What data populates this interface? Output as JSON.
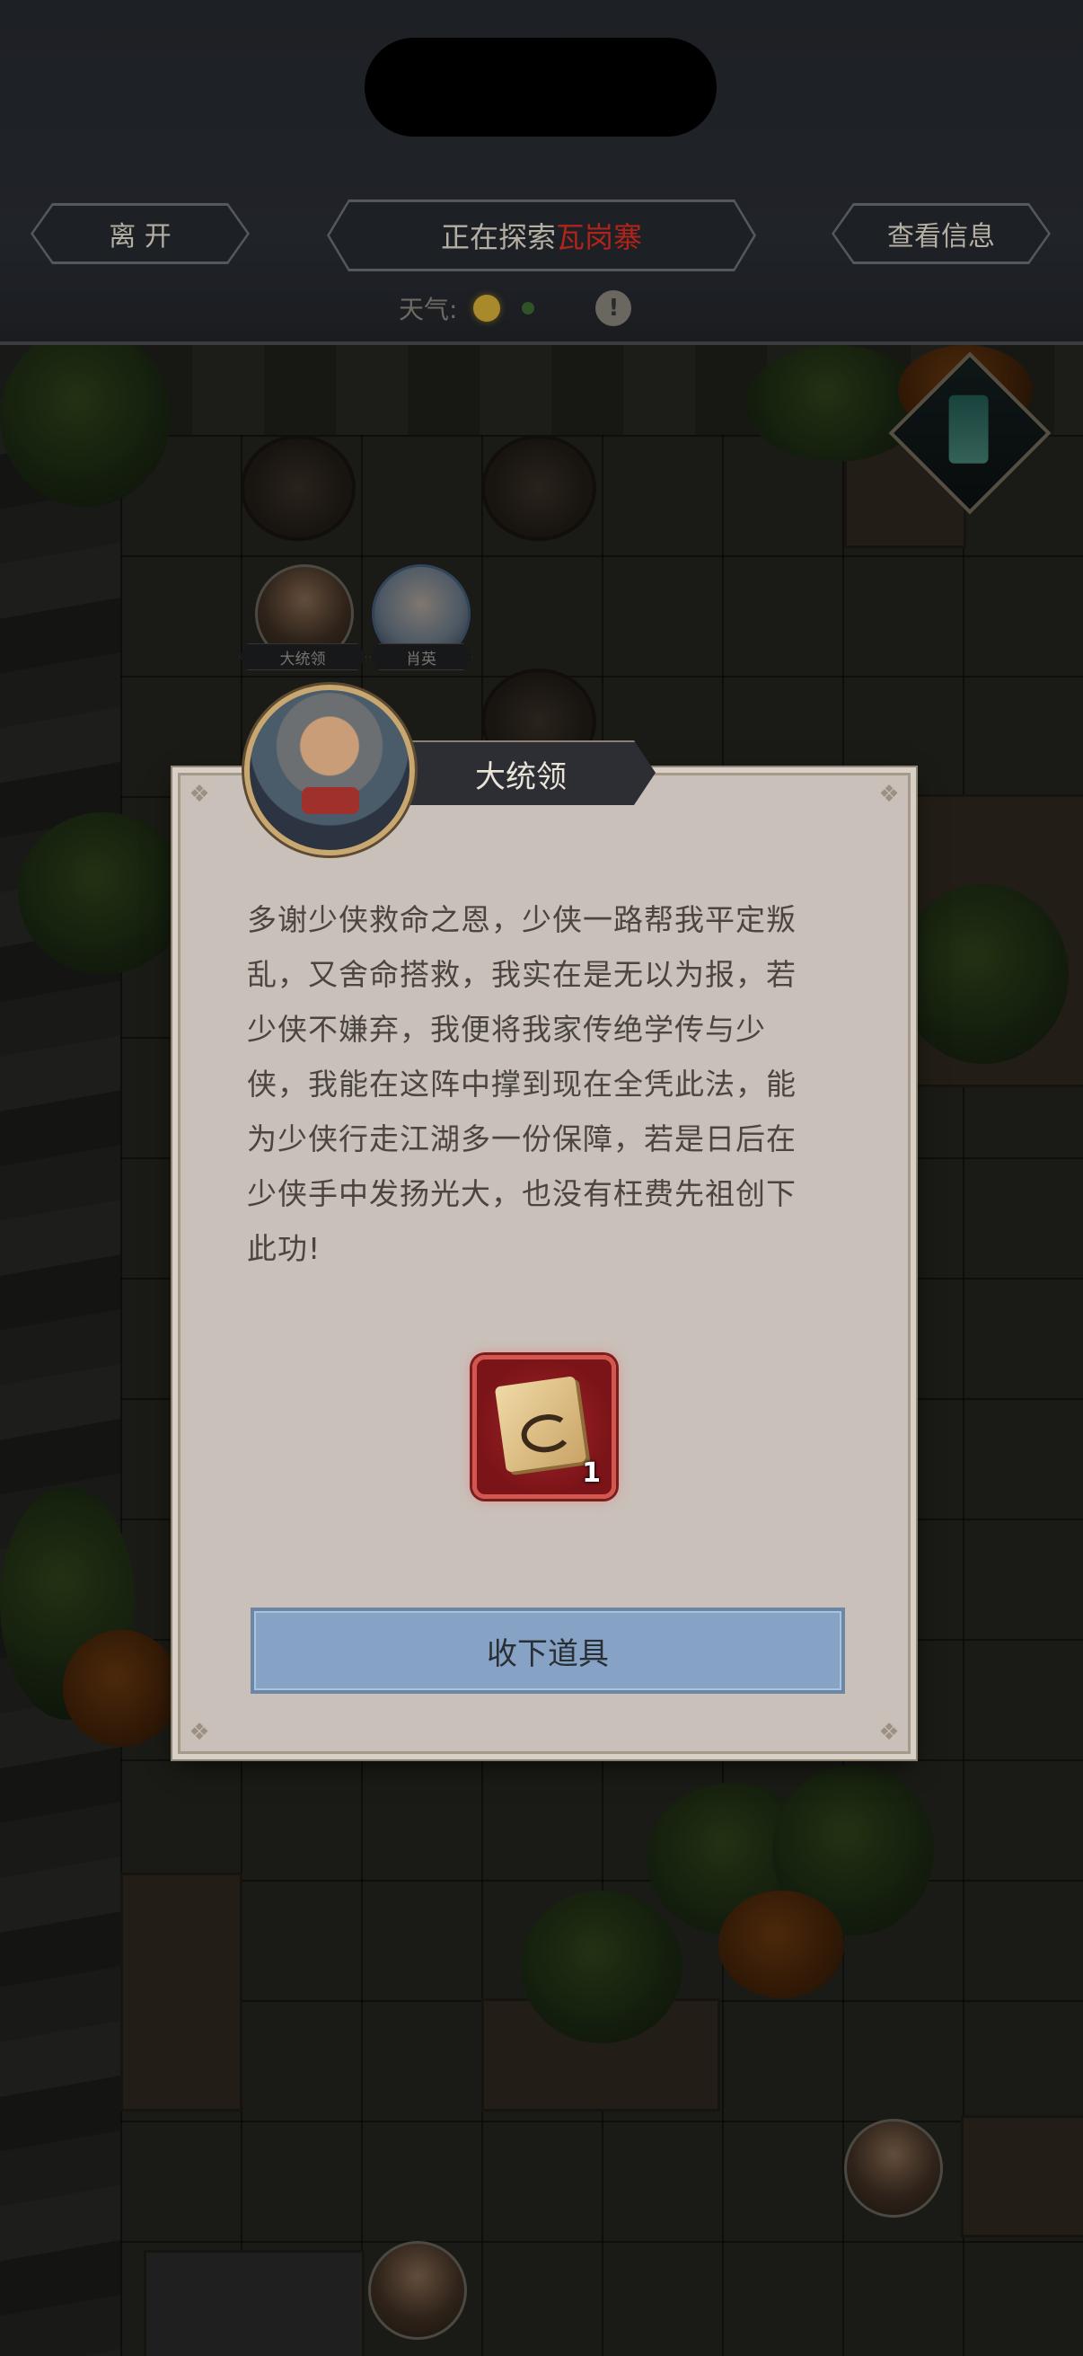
{
  "header": {
    "leave_label": "离 开",
    "exploring_prefix": "正在探索",
    "location_name": "瓦岗寨",
    "info_label": "查看信息",
    "weather_label": "天气:",
    "warning_symbol": "!"
  },
  "map": {
    "tokens": [
      {
        "name": "大统领"
      },
      {
        "name": "肖英"
      }
    ]
  },
  "dialog": {
    "speaker": "大统领",
    "text": "多谢少侠救命之恩，少侠一路帮我平定叛乱，又舍命搭救，我实在是无以为报，若少侠不嫌弃，我便将我家传绝学传与少侠，我能在这阵中撑到现在全凭此法，能为少侠行走江湖多一份保障，若是日后在少侠手中发扬光大，也没有枉费先祖创下此功!",
    "reward": {
      "icon": "book-icon",
      "count": "1"
    },
    "accept_label": "收下道具"
  },
  "colors": {
    "location_red": "#b0241b",
    "dialog_bg": "#c9c0ba",
    "accept_button": "#86a3c6",
    "reward_frame": "#a2252a"
  }
}
